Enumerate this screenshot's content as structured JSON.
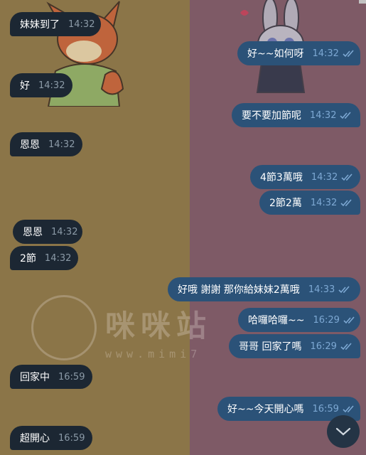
{
  "messages": [
    {
      "side": "in",
      "text": "妹妹到了",
      "time": "14:32"
    },
    {
      "side": "out",
      "text": "好~~如何呀",
      "time": "14:32"
    },
    {
      "side": "in",
      "text": "好",
      "time": "14:32"
    },
    {
      "side": "out",
      "text": "要不要加節呢",
      "time": "14:32"
    },
    {
      "side": "in",
      "text": "恩恩",
      "time": "14:32"
    },
    {
      "side": "out",
      "text": "4節3萬哦",
      "time": "14:32"
    },
    {
      "side": "out",
      "text": "2節2萬",
      "time": "14:32"
    },
    {
      "side": "in",
      "text": "恩恩",
      "time": "14:32"
    },
    {
      "side": "in",
      "text": "2節",
      "time": "14:32"
    },
    {
      "side": "out",
      "text": "好哦  謝謝 那你給妹妹2萬哦",
      "time": "14:33"
    },
    {
      "side": "out",
      "text": "哈囉哈囉~~",
      "time": "16:29"
    },
    {
      "side": "out",
      "text": "哥哥 回家了嗎",
      "time": "16:29"
    },
    {
      "side": "in",
      "text": "回家中",
      "time": "16:59"
    },
    {
      "side": "out",
      "text": "好~~今天開心嗎",
      "time": "16:59"
    },
    {
      "side": "in",
      "text": "超開心",
      "time": "16:59"
    }
  ],
  "watermark": {
    "text": "咪咪站",
    "url": "www.mimi7"
  },
  "icons": {
    "read_receipt": "double-check-icon",
    "scroll_down": "chevron-down-icon"
  },
  "colors": {
    "incoming_bubble": "#1c2733",
    "outgoing_bubble": "#2b5278",
    "incoming_time": "#8b9aa7",
    "outgoing_time": "#7da8d3",
    "wallpaper_left": "#8b7548",
    "wallpaper_right": "#7e5a66"
  }
}
